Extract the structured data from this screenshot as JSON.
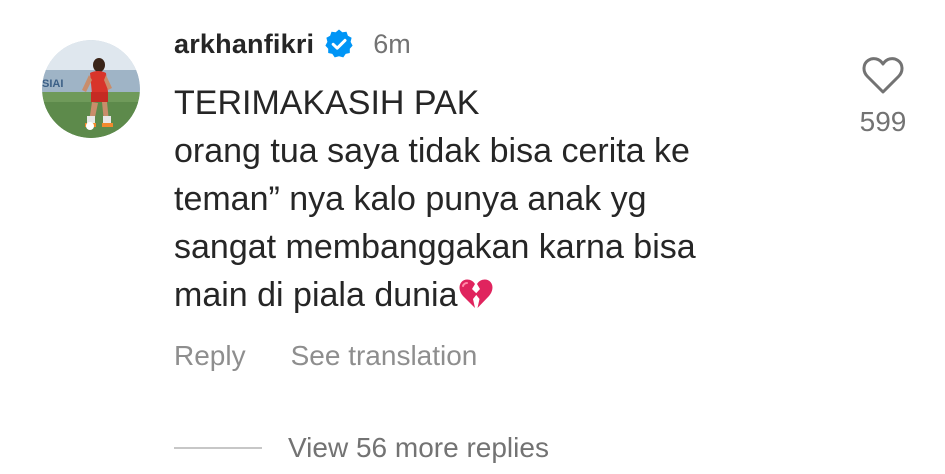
{
  "comment": {
    "username": "arkhanfikri",
    "verified_icon": "verified-badge-icon",
    "time_ago": "6m",
    "avatar_logo_text": "SIAI",
    "lines": [
      "TERIMAKASIH PAK",
      "orang tua saya tidak bisa cerita ke",
      "teman” nya kalo punya anak yg",
      "sangat membanggakan karna bisa",
      "main di piala dunia"
    ],
    "trailing_emoji": "broken-heart-emoji",
    "reply_label": "Reply",
    "see_translation_label": "See translation",
    "like_icon": "heart-outline-icon",
    "like_count": "599",
    "view_replies_label": "View 56 more replies"
  },
  "colors": {
    "text_primary": "#262626",
    "text_secondary": "#737373",
    "verified_blue": "#0095f6",
    "broken_heart": "#e0245e"
  }
}
